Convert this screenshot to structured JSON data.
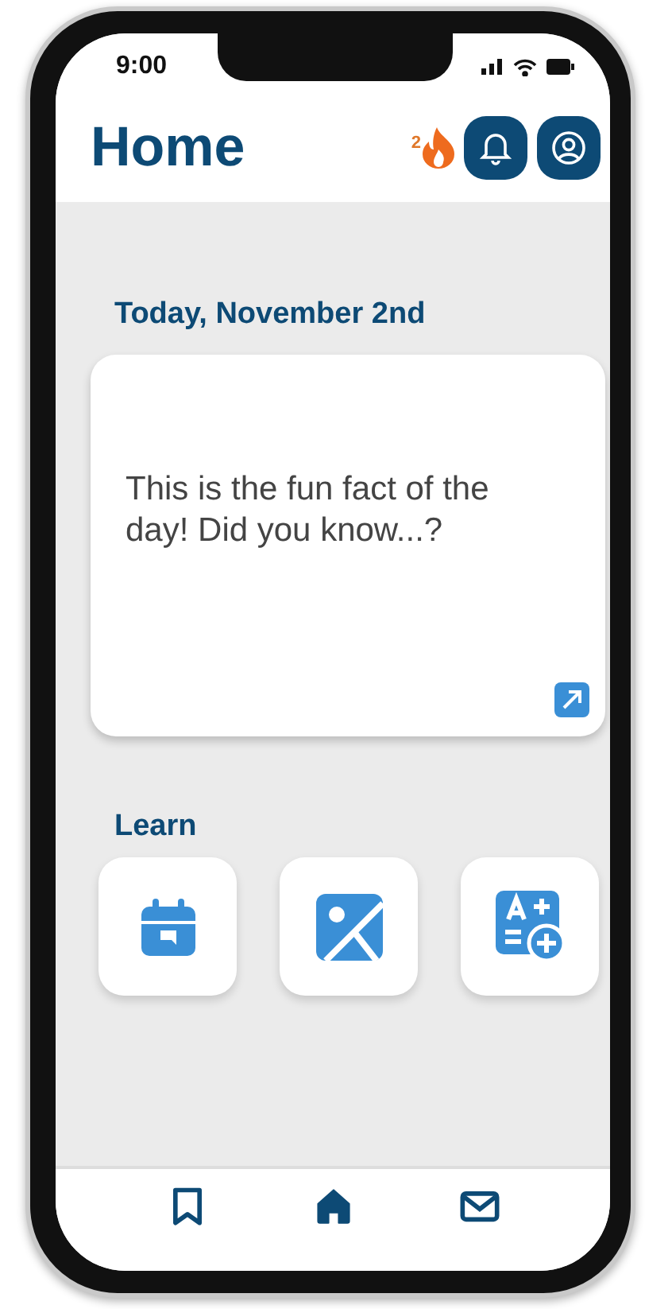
{
  "status_bar": {
    "time": "9:00"
  },
  "header": {
    "title": "Home",
    "streak": "2"
  },
  "date": "Today, November 2nd",
  "fact_card": {
    "text": "This is the fun fact of the day! Did you know...?"
  },
  "learn": {
    "title": "Learn",
    "tiles": [
      {
        "kind": "calendar"
      },
      {
        "kind": "image"
      },
      {
        "kind": "grades"
      }
    ]
  },
  "nav": [
    {
      "kind": "bookmark",
      "selected": false
    },
    {
      "kind": "home",
      "selected": true
    },
    {
      "kind": "mail",
      "selected": false
    }
  ]
}
